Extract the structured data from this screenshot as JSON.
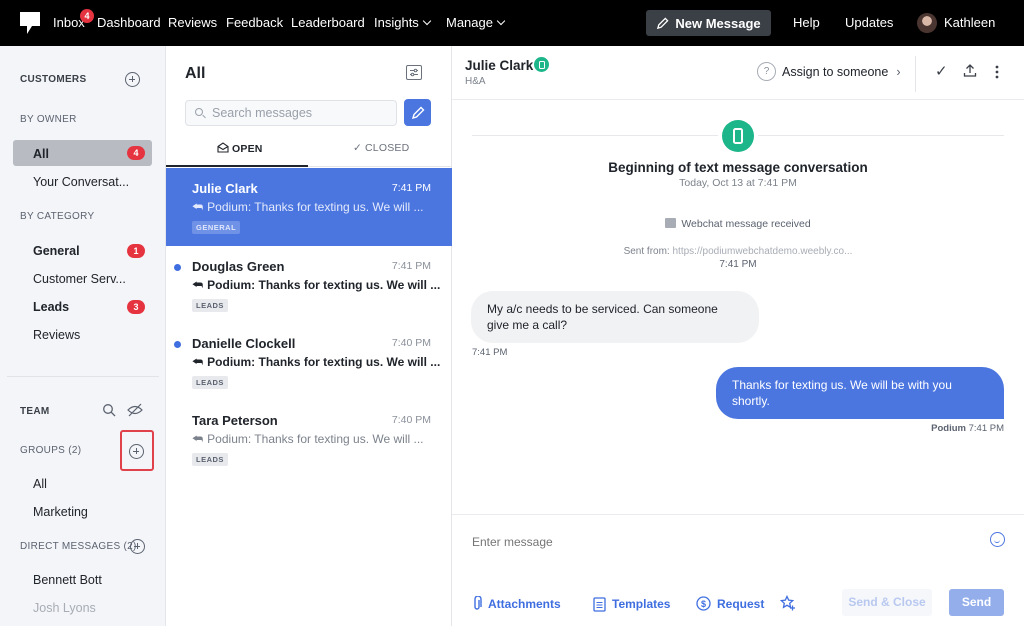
{
  "topnav": {
    "items": [
      "Inbox",
      "Dashboard",
      "Reviews",
      "Feedback",
      "Leaderboard",
      "Insights",
      "Manage"
    ],
    "inbox_badge": "4",
    "new_message_label": "New Message",
    "help_label": "Help",
    "updates_label": "Updates",
    "user_name": "Kathleen"
  },
  "sidebar": {
    "customers_label": "CUSTOMERS",
    "by_owner_label": "BY OWNER",
    "owner_items": [
      {
        "label": "All",
        "badge": "4"
      },
      {
        "label": "Your Conversat..."
      }
    ],
    "by_category_label": "BY CATEGORY",
    "category_items": [
      {
        "label": "General",
        "badge": "1"
      },
      {
        "label": "Customer Serv..."
      },
      {
        "label": "Leads",
        "badge": "3"
      },
      {
        "label": "Reviews"
      }
    ],
    "team_label": "TEAM",
    "groups_label": "GROUPS (2)",
    "group_items": [
      "All",
      "Marketing"
    ],
    "direct_messages_label": "DIRECT MESSAGES (2)",
    "dm_items": [
      "Bennett Bott",
      "Josh Lyons"
    ]
  },
  "conversation_list": {
    "title": "All",
    "search_placeholder": "Search messages",
    "tabs": {
      "open": "OPEN",
      "closed": "CLOSED"
    },
    "conversations": [
      {
        "name": "Julie Clark",
        "time": "7:41 PM",
        "preview": "Podium: Thanks for texting us. We will ...",
        "tag": "GENERAL",
        "selected": true,
        "unread": false
      },
      {
        "name": "Douglas Green",
        "time": "7:41 PM",
        "preview": "Podium: Thanks for texting us. We will ...",
        "tag": "LEADS",
        "selected": false,
        "unread": true
      },
      {
        "name": "Danielle Clockell",
        "time": "7:40 PM",
        "preview": "Podium: Thanks for texting us. We will ...",
        "tag": "LEADS",
        "selected": false,
        "unread": true
      },
      {
        "name": "Tara Peterson",
        "time": "7:40 PM",
        "preview": "Podium: Thanks for texting us. We will ...",
        "tag": "LEADS",
        "selected": false,
        "unread": false
      }
    ]
  },
  "chat": {
    "contact_name": "Julie Clark",
    "contact_sub": "H&A",
    "assign_label": "Assign to someone",
    "begin_title": "Beginning of text message conversation",
    "begin_subtitle": "Today, Oct 13 at 7:41 PM",
    "webchat_label": "Webchat message received",
    "sent_from_label": "Sent from:",
    "sent_from_url": "https://podiumwebchatdemo.weebly.co...",
    "sent_time": "7:41 PM",
    "messages": [
      {
        "direction": "in",
        "text": "My a/c needs to be serviced. Can someone give me a call?",
        "time": "7:41 PM"
      },
      {
        "direction": "out",
        "text": "Thanks for texting us. We will be with you shortly.",
        "sender": "Podium",
        "time": "7:41 PM"
      }
    ],
    "composer": {
      "placeholder": "Enter message",
      "attachments_label": "Attachments",
      "templates_label": "Templates",
      "request_label": "Request",
      "send_close_label": "Send & Close",
      "send_label": "Send"
    }
  },
  "colors": {
    "accent": "#4b76e0",
    "badge": "#e5343f",
    "channel_green": "#1db68a",
    "nav_bg": "#000000"
  }
}
